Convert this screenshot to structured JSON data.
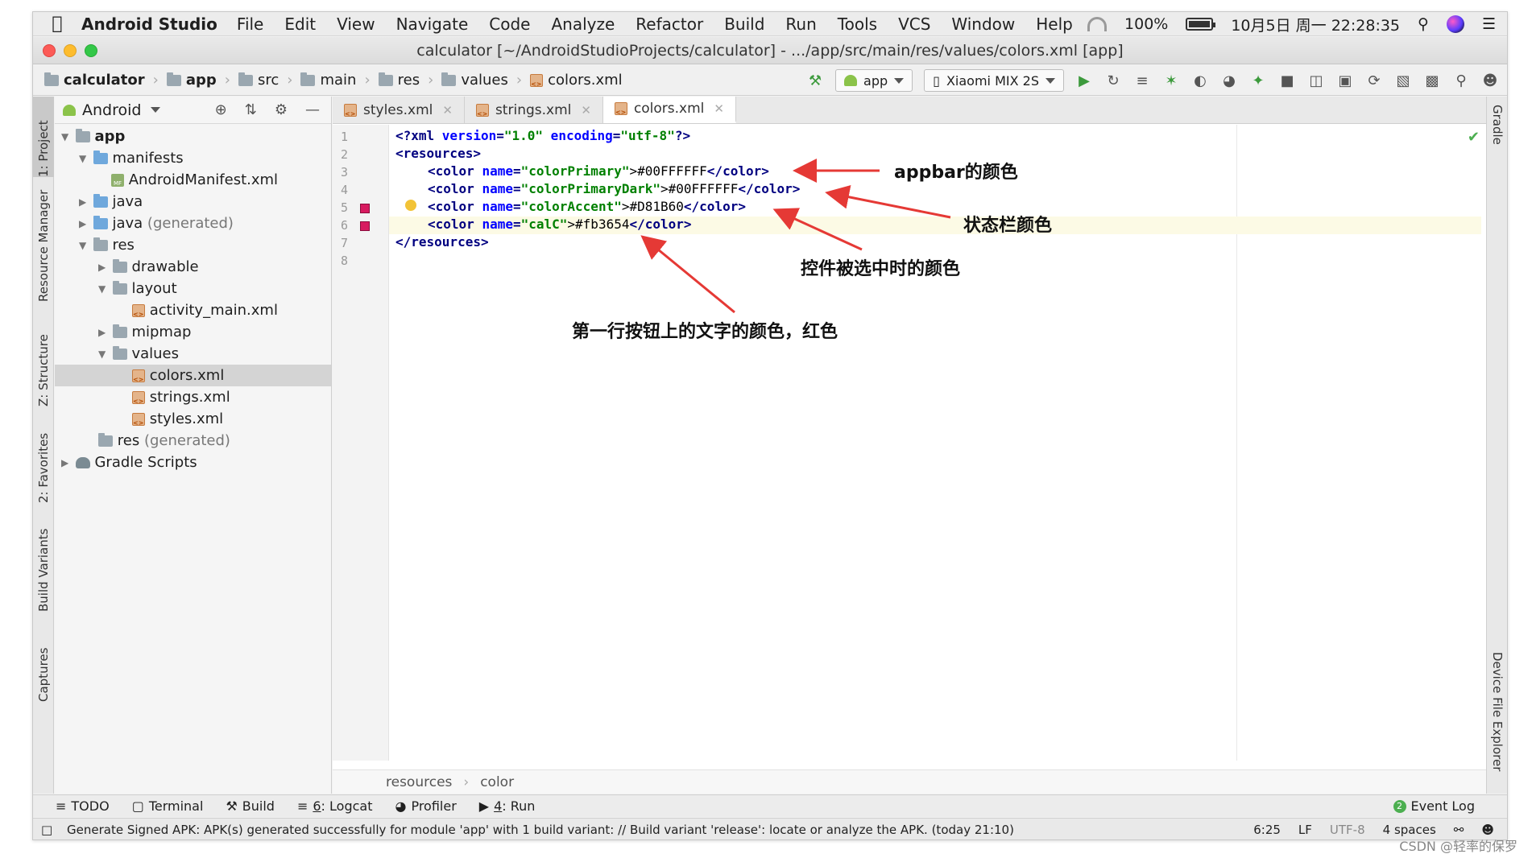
{
  "menubar": {
    "app": "Android Studio",
    "items": [
      "File",
      "Edit",
      "View",
      "Navigate",
      "Code",
      "Analyze",
      "Refactor",
      "Build",
      "Run",
      "Tools",
      "VCS",
      "Window",
      "Help"
    ],
    "battery": "100%",
    "clock": "10月5日 周一 22:28:35"
  },
  "window": {
    "title": "calculator [~/AndroidStudioProjects/calculator] - .../app/src/main/res/values/colors.xml [app]"
  },
  "navbar": {
    "crumbs": [
      "calculator",
      "app",
      "src",
      "main",
      "res",
      "values",
      "colors.xml"
    ],
    "run_config": "app",
    "device": "Xiaomi MIX 2S"
  },
  "left_tabs": [
    "1: Project",
    "Resource Manager",
    "Z: Structure",
    "2: Favorites",
    "Build Variants",
    "Captures"
  ],
  "right_tabs": [
    "Gradle",
    "Device File Explorer"
  ],
  "project": {
    "view": "Android",
    "tree": [
      {
        "label": "app",
        "bold": true
      },
      {
        "label": "manifests"
      },
      {
        "label": "AndroidManifest.xml"
      },
      {
        "label": "java"
      },
      {
        "label": "java",
        "suffix": "(generated)"
      },
      {
        "label": "res"
      },
      {
        "label": "drawable"
      },
      {
        "label": "layout"
      },
      {
        "label": "activity_main.xml"
      },
      {
        "label": "mipmap"
      },
      {
        "label": "values"
      },
      {
        "label": "colors.xml"
      },
      {
        "label": "strings.xml"
      },
      {
        "label": "styles.xml"
      },
      {
        "label": "res",
        "suffix": "(generated)"
      },
      {
        "label": "Gradle Scripts"
      }
    ]
  },
  "editor": {
    "tabs": [
      "styles.xml",
      "strings.xml",
      "colors.xml"
    ],
    "line_numbers": [
      "1",
      "2",
      "3",
      "4",
      "5",
      "6",
      "7",
      "8"
    ],
    "lines": {
      "l1_a": "<?xml ",
      "l1_b": "version",
      "l1_c": "=",
      "l1_d": "\"1.0\"",
      "l1_e": " encoding",
      "l1_f": "=",
      "l1_g": "\"utf-8\"",
      "l1_h": "?>",
      "l2": "<resources>",
      "color_open": "<color ",
      "name_attr": "name",
      "eq": "=",
      "c1_name": "\"colorPrimary\"",
      "c1_val": ">#00FFFFFF",
      "c2_name": "\"colorPrimaryDark\"",
      "c2_val": ">#00FFFFFF",
      "c3_name": "\"colorAccent\"",
      "c3_val": ">#D81B60",
      "c4_name": "\"calC\"",
      "c4_val": ">#fb3654",
      "color_close": "</color>",
      "l7": "</resources>"
    },
    "breadcrumb": [
      "resources",
      "color"
    ]
  },
  "annotations": {
    "appbar": "appbar的颜色",
    "statusbar": "状态栏颜色",
    "selected": "控件被选中时的颜色",
    "buttontext": "第一行按钮上的文字的颜色，红色"
  },
  "bottom_tools": {
    "todo": "TODO",
    "terminal": "Terminal",
    "build": "Build",
    "logcat_num": "6",
    "logcat": ": Logcat",
    "profiler": "Profiler",
    "run_num": "4",
    "run": ": Run",
    "event_log": "Event Log",
    "event_count": "2"
  },
  "status": {
    "message": "Generate Signed APK: APK(s) generated successfully for module 'app' with 1 build variant: // Build variant 'release': locate or analyze the APK. (today 21:10)",
    "position": "6:25",
    "line_sep": "LF",
    "encoding": "UTF-8",
    "indent": "4 spaces"
  },
  "watermark": "CSDN @轻率的保罗",
  "colors": {
    "arrow": "#e53935",
    "marker": "#d81b60"
  }
}
